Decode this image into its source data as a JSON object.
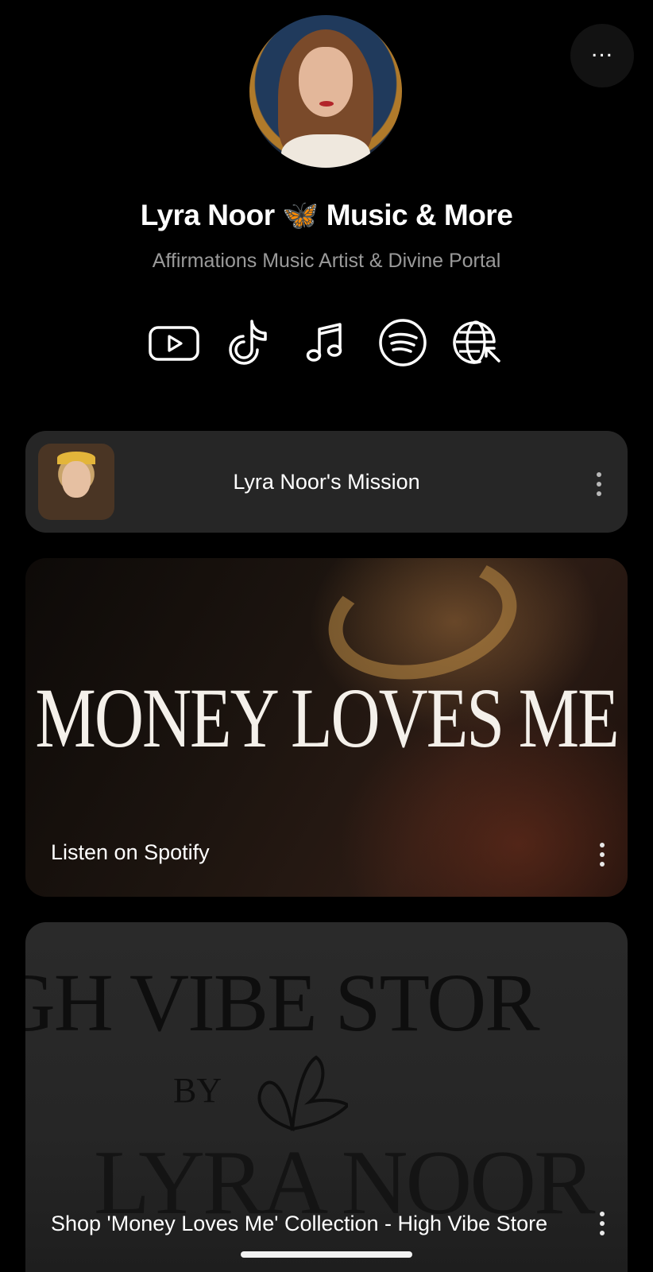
{
  "profile": {
    "name": "Lyra Noor 🦋 Music & More",
    "bio": "Affirmations Music Artist & Divine Portal",
    "more_label": "..."
  },
  "socials": [
    {
      "icon": "youtube-icon"
    },
    {
      "icon": "tiktok-icon"
    },
    {
      "icon": "music-note-icon"
    },
    {
      "icon": "spotify-icon"
    },
    {
      "icon": "website-globe-icon"
    }
  ],
  "links": [
    {
      "label": "Lyra Noor's Mission"
    },
    {
      "label": "Listen on Spotify",
      "image_text": "MONEY LOVES ME"
    },
    {
      "label": "Shop 'Money Loves Me' Collection - High Vibe Store",
      "image_text": {
        "line1": "IGH VIBE STOR",
        "line2": "BY",
        "line3": "LYRA NOOR"
      }
    }
  ],
  "colors": {
    "background": "#000000",
    "card": "#262626",
    "subtitle": "#9a9a9a"
  }
}
